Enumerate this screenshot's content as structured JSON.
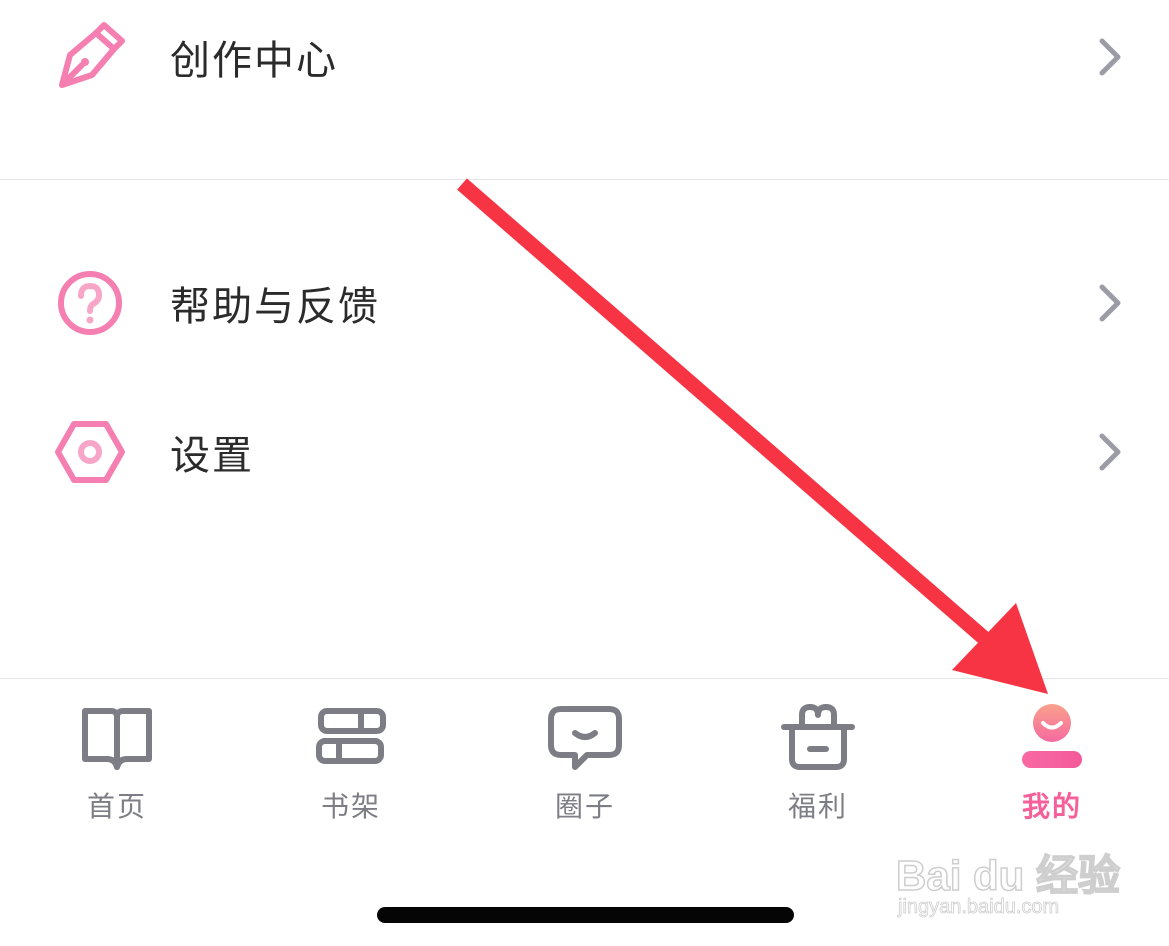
{
  "menu": {
    "items": [
      {
        "label": "创作中心",
        "icon": "pen-nib-icon"
      },
      {
        "label": "帮助与反馈",
        "icon": "help-question-icon"
      },
      {
        "label": "设置",
        "icon": "settings-hexagon-icon"
      }
    ]
  },
  "tabbar": {
    "tabs": [
      {
        "label": "首页",
        "icon": "book-open-icon",
        "active": false
      },
      {
        "label": "书架",
        "icon": "bookshelf-icon",
        "active": false
      },
      {
        "label": "圈子",
        "icon": "chat-bubble-icon",
        "active": false
      },
      {
        "label": "福利",
        "icon": "gift-bag-icon",
        "active": false
      },
      {
        "label": "我的",
        "icon": "profile-icon",
        "active": true
      }
    ]
  },
  "colors": {
    "accent": "#f6609a",
    "icon_pink": "#f47fb0",
    "inactive_gray": "#7d7e85",
    "chevron_gray": "#9b9ca6",
    "arrow_red": "#f73444"
  },
  "watermark": {
    "logo": "Bai du 经验",
    "url": "jingyan.baidu.com"
  }
}
